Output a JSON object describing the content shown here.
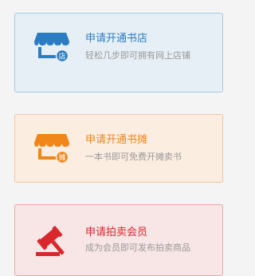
{
  "cards": [
    {
      "title": "申请开通书店",
      "description": "轻松几步即可拥有网上店铺",
      "icon": "storefront-icon",
      "badge": "店",
      "color": "#2b7cc3"
    },
    {
      "title": "申请开通书摊",
      "description": "一本书即可免费开摊卖书",
      "icon": "stall-icon",
      "badge": "摊",
      "color": "#f08519"
    },
    {
      "title": "申请拍卖会员",
      "description": "成为会员即可发布拍卖商品",
      "icon": "gavel-icon",
      "color": "#d9272e"
    }
  ]
}
